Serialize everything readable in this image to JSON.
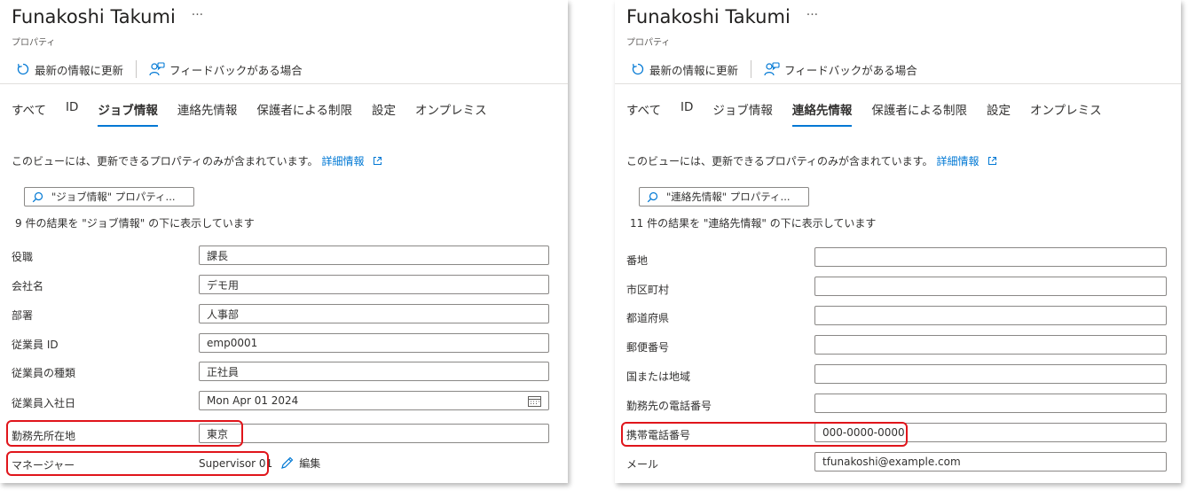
{
  "left": {
    "title": "Funakoshi Takumi",
    "more": "···",
    "subtitle": "プロパティ",
    "refresh_label": "最新の情報に更新",
    "feedback_label": "フィードバックがある場合",
    "tabs": [
      "すべて",
      "ID",
      "ジョブ情報",
      "連絡先情報",
      "保護者による制限",
      "設定",
      "オンプレミス"
    ],
    "active_tab": "ジョブ情報",
    "description": "このビューには、更新できるプロパティのみが含まれています。",
    "learn_more": "詳細情報",
    "search_placeholder": "\"ジョブ情報\" プロパティ...",
    "result_count": "9 件の結果を \"ジョブ情報\" の下に表示しています",
    "fields": [
      {
        "label": "役職",
        "value": "課長"
      },
      {
        "label": "会社名",
        "value": "デモ用"
      },
      {
        "label": "部署",
        "value": "人事部"
      },
      {
        "label": "従業員 ID",
        "value": "emp0001"
      },
      {
        "label": "従業員の種類",
        "value": "正社員"
      },
      {
        "label": "従業員入社日",
        "value": "Mon Apr 01 2024"
      },
      {
        "label": "勤務先所在地",
        "value": "東京"
      },
      {
        "label": "マネージャー",
        "value": "Supervisor 01",
        "edit": "編集"
      }
    ]
  },
  "right": {
    "title": "Funakoshi Takumi",
    "more": "···",
    "subtitle": "プロパティ",
    "refresh_label": "最新の情報に更新",
    "feedback_label": "フィードバックがある場合",
    "tabs": [
      "すべて",
      "ID",
      "ジョブ情報",
      "連絡先情報",
      "保護者による制限",
      "設定",
      "オンプレミス"
    ],
    "active_tab": "連絡先情報",
    "description": "このビューには、更新できるプロパティのみが含まれています。",
    "learn_more": "詳細情報",
    "search_placeholder": "\"連絡先情報\" プロパティ...",
    "result_count": "11 件の結果を \"連絡先情報\" の下に表示しています",
    "fields": [
      {
        "label": "番地",
        "value": ""
      },
      {
        "label": "市区町村",
        "value": ""
      },
      {
        "label": "都道府県",
        "value": ""
      },
      {
        "label": "郵便番号",
        "value": ""
      },
      {
        "label": "国または地域",
        "value": ""
      },
      {
        "label": "勤務先の電話番号",
        "value": ""
      },
      {
        "label": "携帯電話番号",
        "value": "000-0000-0000"
      },
      {
        "label": "メール",
        "value": "tfunakoshi@example.com"
      }
    ]
  },
  "colors": {
    "accent": "#0078d4",
    "highlight": "#e0151b"
  }
}
